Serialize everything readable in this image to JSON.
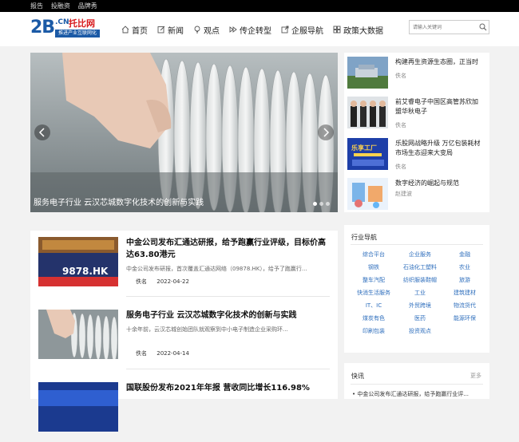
{
  "topbar": {
    "links": [
      "报告",
      "投融资",
      "品牌秀"
    ]
  },
  "logo": {
    "big": "2B",
    "cn": ".CN",
    "brand": "托比网",
    "slogan": "推进产业互联网化"
  },
  "nav": {
    "items": [
      "首页",
      "新闻",
      "观点",
      "传企转型",
      "企服导航",
      "政策大数据"
    ]
  },
  "search": {
    "placeholder": "请输入关键词"
  },
  "carousel": {
    "caption": "服务电子行业 云汉芯城数字化技术的创新与实践"
  },
  "side_list": [
    {
      "title": "构建再生资源生态圈，正当时",
      "author": "佚名"
    },
    {
      "title": "前艾睿电子中国区高管苏欣加盟华秋电子",
      "author": "佚名"
    },
    {
      "title": "乐股网战略升级 万亿包装耗材市场生态迎来大变局",
      "author": "佚名",
      "thumb_text": "乐享工厂"
    },
    {
      "title": "数字经济的崛起与规范",
      "author": "赵建波"
    }
  ],
  "articles": [
    {
      "title": "中金公司发布汇通达研报，给予跑赢行业评级，目标价高达63.80港元",
      "summary": "中金公司发布研报，首次覆盖汇通达网络（09878.HK），给予了跑赢行...",
      "author": "佚名",
      "date": "2022-04-22",
      "thumb_text": "9878.HK"
    },
    {
      "title": "服务电子行业 云汉芯城数字化技术的创新与实践",
      "summary": "十余年前，云汉芯城创始团队就观察到中小电子制造企业采购环...",
      "author": "佚名",
      "date": "2022-04-14"
    },
    {
      "title": "国联股份发布2021年年报 营收同比增长116.98%"
    }
  ],
  "industry": {
    "heading": "行业导航",
    "items": [
      "综合平台",
      "企业服务",
      "金融",
      "钢铁",
      "石油化工塑料",
      "农业",
      "整车汽配",
      "纺织服装鞋帽",
      "旅游",
      "快消生活服务",
      "工业",
      "建筑建材",
      "IT、IC",
      "外贸跨境",
      "物流货代",
      "煤炭有色",
      "医药",
      "能源环保",
      "印刷包装",
      "投资观点"
    ]
  },
  "news": {
    "heading": "快讯",
    "more": "更多",
    "items": [
      "中金公司发布汇通达研报，给予跑赢行业评..."
    ]
  },
  "colors": {
    "brand_blue": "#1b5aa6",
    "brand_red": "#d7191c",
    "link_blue": "#2f6fbd"
  }
}
